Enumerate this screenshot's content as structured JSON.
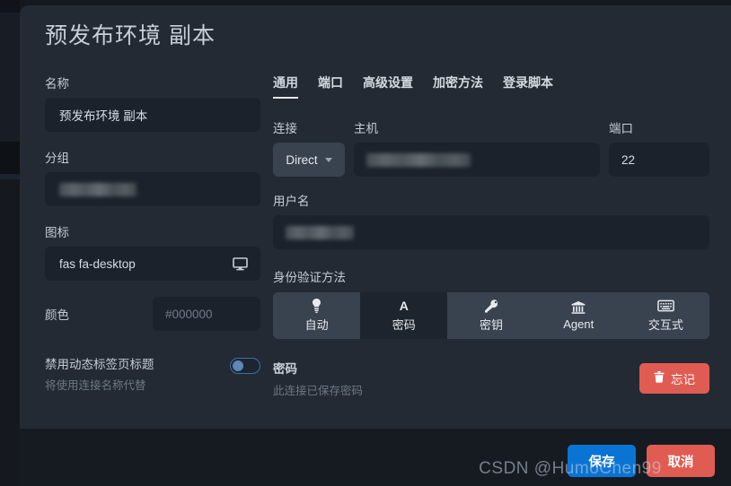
{
  "dialog": {
    "title": "预发布环境 副本"
  },
  "left": {
    "name": {
      "label": "名称",
      "value": "预发布环境 副本"
    },
    "group": {
      "label": "分组",
      "value": "",
      "redacted": true
    },
    "icon": {
      "label": "图标",
      "value": "fas fa-desktop",
      "trailing_icon": "desktop-icon"
    },
    "color": {
      "label": "颜色",
      "placeholder": "#000000",
      "value": ""
    },
    "dynamic_tab_title": {
      "title": "禁用动态标签页标题",
      "subtitle": "将使用连接名称代替",
      "enabled": false
    }
  },
  "right": {
    "tabs": [
      {
        "label": "通用",
        "active": true
      },
      {
        "label": "端口",
        "active": false
      },
      {
        "label": "高级设置",
        "active": false
      },
      {
        "label": "加密方法",
        "active": false
      },
      {
        "label": "登录脚本",
        "active": false
      }
    ],
    "connection": {
      "label": "连接",
      "value": "Direct"
    },
    "host": {
      "label": "主机",
      "value": "",
      "redacted": true
    },
    "port": {
      "label": "端口",
      "value": "22"
    },
    "username": {
      "label": "用户名",
      "value": "",
      "redacted": true
    },
    "auth": {
      "label": "身份验证方法",
      "options": [
        {
          "label": "自动",
          "icon": "magic-lightbulb-icon",
          "selected": false
        },
        {
          "label": "密码",
          "icon": "letter-a-icon",
          "selected": true
        },
        {
          "label": "密钥",
          "icon": "key-icon",
          "selected": false
        },
        {
          "label": "Agent",
          "icon": "bank-icon",
          "selected": false
        },
        {
          "label": "交互式",
          "icon": "keyboard-icon",
          "selected": false
        }
      ]
    },
    "password": {
      "title": "密码",
      "subtitle": "此连接已保存密码",
      "forget_label": "忘记",
      "forget_icon": "trash-icon"
    }
  },
  "footer": {
    "save_label": "保存",
    "cancel_label": "取消"
  },
  "watermark": {
    "text": "CSDN @HumoChen99"
  },
  "colors": {
    "accent_blue": "#0a74d4",
    "danger_red": "#e05c52",
    "dialog_bg": "#232a33",
    "input_bg": "#1b222c",
    "footer_bg": "#161b22",
    "segment_bg": "#39434f",
    "segment_selected_bg": "#1d242e"
  }
}
